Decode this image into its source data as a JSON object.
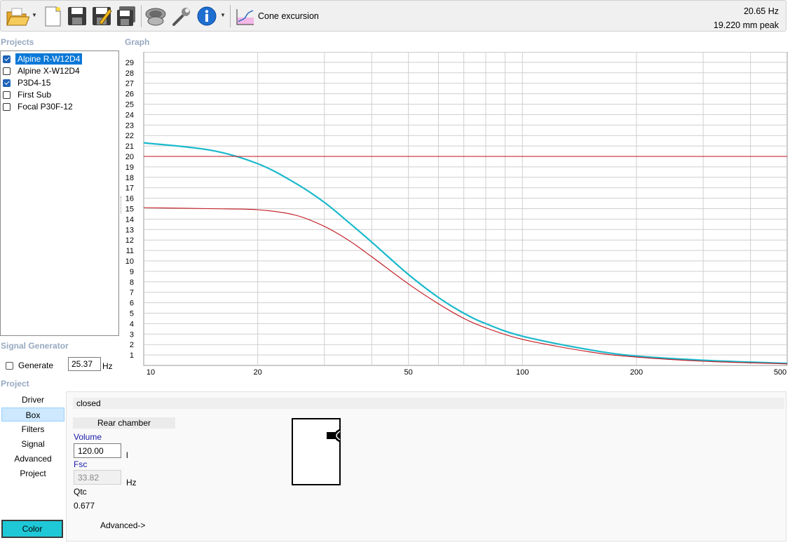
{
  "toolbar": {
    "icons": [
      "open-folder-icon",
      "new-document-icon",
      "save-icon",
      "save-as-icon",
      "save-all-icon",
      "speaker-icon",
      "wrench-icon",
      "info-icon",
      "cone-excursion-icon"
    ],
    "view_label": "Cone excursion"
  },
  "readout": {
    "frequency": "20.65 Hz",
    "peak": "19.220 mm peak"
  },
  "projects": {
    "label": "Projects",
    "items": [
      {
        "name": "Alpine R-W12D4",
        "checked": true,
        "selected": true
      },
      {
        "name": "Alpine X-W12D4",
        "checked": false,
        "selected": false
      },
      {
        "name": "P3D4-15",
        "checked": true,
        "selected": false
      },
      {
        "name": "First Sub",
        "checked": false,
        "selected": false
      },
      {
        "name": "Focal P30F-12",
        "checked": false,
        "selected": false
      }
    ]
  },
  "graph": {
    "label": "Graph",
    "y_ticks": [
      "29",
      "28",
      "27",
      "26",
      "25",
      "24",
      "23",
      "22",
      "21",
      "20",
      "19",
      "18",
      "17",
      "16",
      "15",
      "14",
      "13",
      "12",
      "11",
      "10",
      "9",
      "8",
      "7",
      "6",
      "5",
      "4",
      "3",
      "2",
      "1"
    ],
    "x_ticks": [
      "10",
      "20",
      "50",
      "100",
      "200",
      "500"
    ]
  },
  "chart_data": {
    "type": "line",
    "x_scale": "log",
    "xlim": [
      10,
      500
    ],
    "ylim": [
      0,
      30
    ],
    "grid": true,
    "series": [
      {
        "color": "#1ab9cc",
        "x": [
          10,
          15,
          20,
          25,
          30,
          35,
          40,
          50,
          60,
          70,
          80,
          100,
          150,
          200,
          300,
          500
        ],
        "y": [
          21.3,
          20.6,
          19.3,
          17.5,
          15.6,
          13.6,
          11.8,
          8.7,
          6.5,
          5.0,
          4.0,
          2.8,
          1.5,
          0.9,
          0.5,
          0.2
        ]
      },
      {
        "color": "#c0131b",
        "x": [
          10,
          15,
          20,
          25,
          30,
          35,
          40,
          50,
          60,
          70,
          80,
          100,
          150,
          200,
          300,
          500
        ],
        "y": [
          15.1,
          15.0,
          14.9,
          14.4,
          13.3,
          11.9,
          10.4,
          7.8,
          5.9,
          4.5,
          3.6,
          2.5,
          1.3,
          0.8,
          0.4,
          0.15
        ]
      },
      {
        "color": "#c0131b",
        "x": [
          10,
          500
        ],
        "y": [
          20,
          20
        ]
      }
    ]
  },
  "signal_generator": {
    "label": "Signal Generator",
    "generate_label": "Generate",
    "generate_checked": false,
    "frequency": "25.37",
    "unit": "Hz"
  },
  "project_section": {
    "label": "Project",
    "nav": [
      "Driver",
      "Box",
      "Filters",
      "Signal",
      "Advanced",
      "Project"
    ],
    "active_index": 1,
    "color_button": "Color",
    "color_value": "#1fc8d7"
  },
  "box_panel": {
    "box_type": "closed",
    "rear_chamber_label": "Rear chamber",
    "volume_label": "Volume",
    "volume_value": "120.00",
    "volume_unit": "l",
    "fsc_label": "Fsc",
    "fsc_value": "33.82",
    "fsc_unit": "Hz",
    "qtc_label": "Qtc",
    "qtc_value": "0.677",
    "advanced_link": "Advanced->"
  }
}
